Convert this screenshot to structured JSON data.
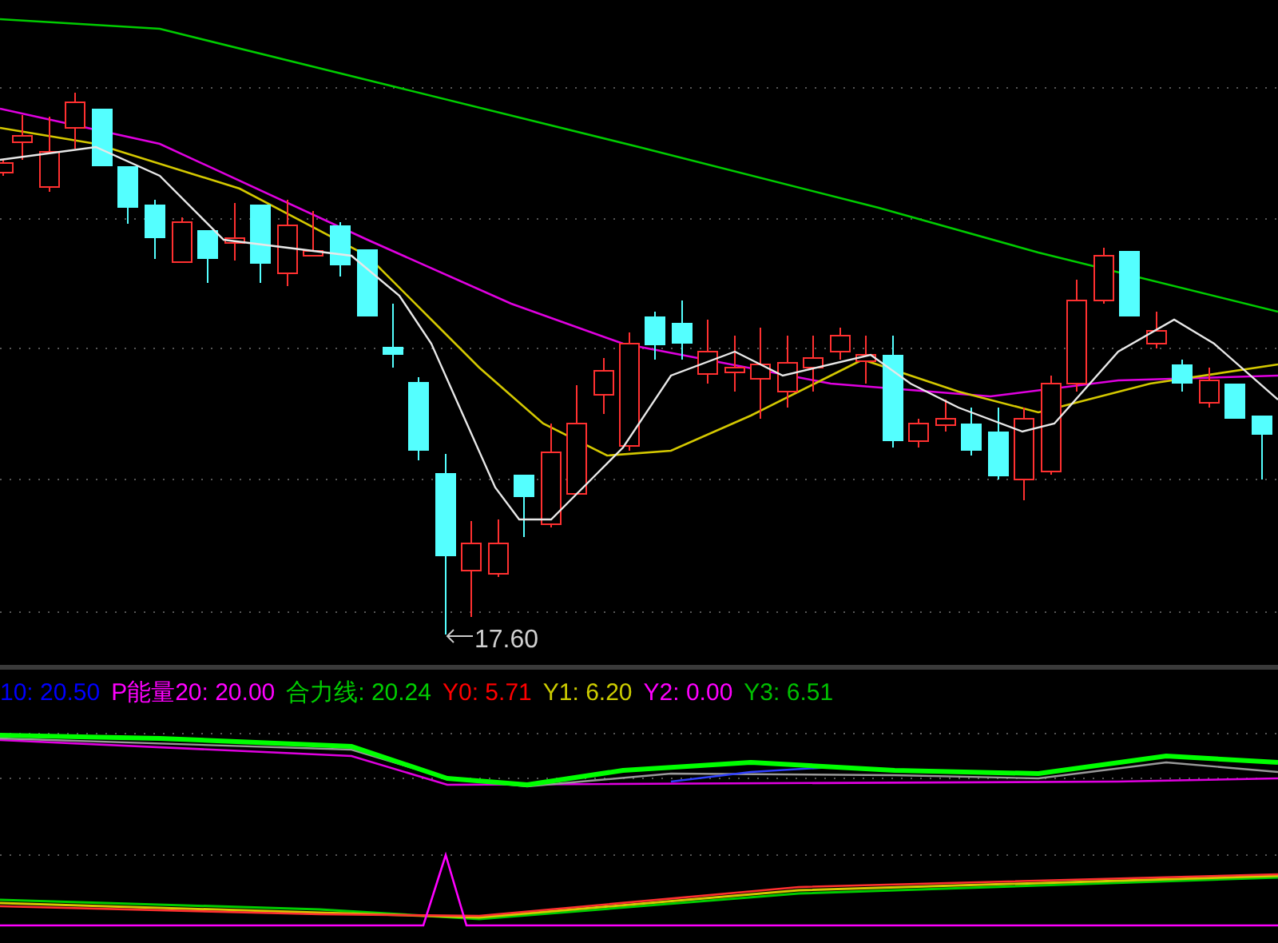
{
  "price_chart": {
    "low_marker": "17.60"
  },
  "indicator_legend": [
    {
      "text": "10: 20.50",
      "color": "#0000ff"
    },
    {
      "text": "P能量20: 20.00",
      "color": "#ff00ff"
    },
    {
      "text": "合力线: 20.24",
      "color": "#00cc00"
    },
    {
      "text": "Y0: 5.71",
      "color": "#ff0000"
    },
    {
      "text": "Y1: 6.20",
      "color": "#cccc00"
    },
    {
      "text": "Y2: 0.00",
      "color": "#ff00ff"
    },
    {
      "text": "Y3: 6.51",
      "color": "#00c000"
    }
  ]
}
